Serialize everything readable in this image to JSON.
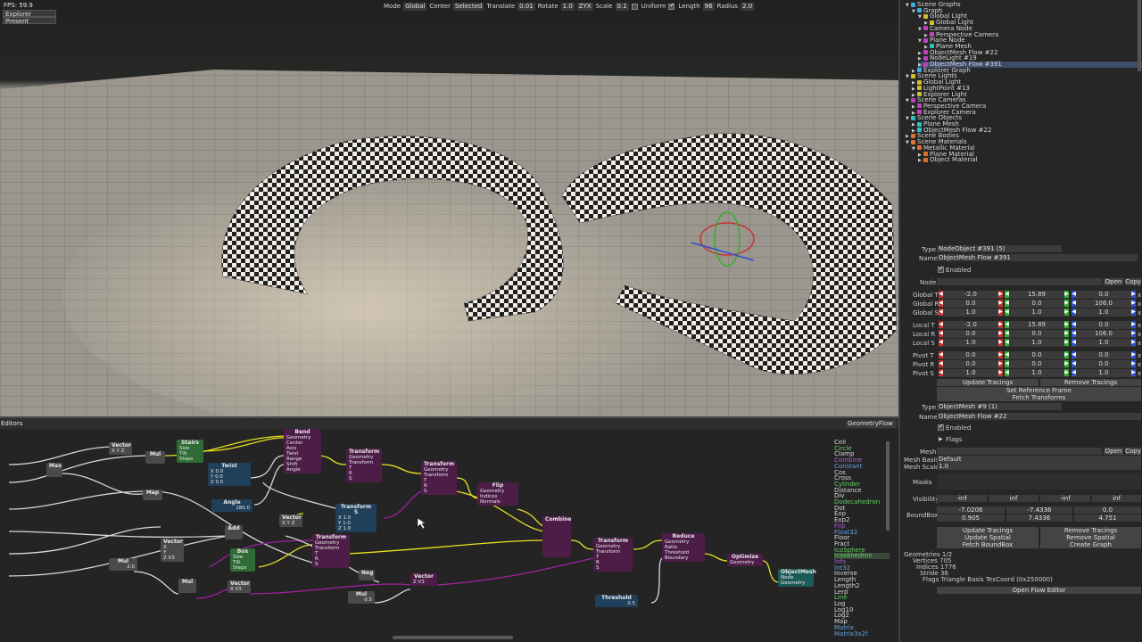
{
  "viewport": {
    "fps": "FPS: 59.9",
    "camera": "Explorer Camera",
    "present": "Present",
    "toolbar": {
      "mode_label": "Mode",
      "mode_value": "Global",
      "center_label": "Center",
      "center_value": "Selected",
      "translate_label": "Translate",
      "translate_value": "0.01",
      "rotate_label": "Rotate",
      "rotate_value": "1.0",
      "order_value": "ZYX",
      "scale_label": "Scale",
      "scale_value": "0.1",
      "uniform_label": "Uniform",
      "length_label": "Length",
      "length_value": "96",
      "radius_label": "Radius",
      "radius_value": "2.0"
    }
  },
  "editors": {
    "title": "Editors",
    "flow_type": "GeometryFlow",
    "nodes": {
      "vector1": {
        "title": "Vector",
        "rows": [
          "X Y Z"
        ]
      },
      "max": {
        "title": "Max"
      },
      "mul1": {
        "title": "Mul"
      },
      "stairs": {
        "title": "Stairs",
        "rows": [
          "Size",
          "Tilt",
          "Steps"
        ]
      },
      "twist": {
        "title": "Twist",
        "rows": [
          "X 0.0",
          "Y 0.0",
          "Z 0.0"
        ]
      },
      "angle": {
        "title": "Angle",
        "rows": [
          "180.0"
        ]
      },
      "bend": {
        "title": "Bend",
        "rows": [
          "Geometry",
          "Center",
          "Axis",
          "Twist",
          "Range",
          "Shift",
          "Angle"
        ]
      },
      "transform1": {
        "title": "Transform",
        "rows": [
          "Geometry",
          "Transform",
          "T",
          "R",
          "S"
        ]
      },
      "transform2": {
        "title": "Transform",
        "rows": [
          "Geometry",
          "Transform",
          "T",
          "R",
          "S"
        ]
      },
      "flip": {
        "title": "Flip",
        "rows": [
          "Geometry",
          "Indices",
          "Normals"
        ]
      },
      "transform_s": {
        "title": "Transform S",
        "rows": [
          "X 1.0",
          "Y 1.0",
          "Z 1.0"
        ]
      },
      "vector2": {
        "title": "Vector",
        "rows": [
          "X Y Z"
        ]
      },
      "map": {
        "title": "Map"
      },
      "add": {
        "title": "Add"
      },
      "transform3": {
        "title": "Transform",
        "rows": [
          "Geometry",
          "Transform",
          "T",
          "R",
          "S"
        ]
      },
      "box": {
        "title": "Box",
        "rows": [
          "Size",
          "Tilt",
          "Steps"
        ]
      },
      "vector3": {
        "title": "Vector",
        "rows": [
          "X",
          "Y",
          "Z V3"
        ]
      },
      "mul2": {
        "title": "Mul",
        "rows": [
          "2.0"
        ]
      },
      "mul3": {
        "title": "Mul"
      },
      "vector4": {
        "title": "Vector",
        "rows": [
          "X V3"
        ]
      },
      "neg": {
        "title": "Neg"
      },
      "mul4": {
        "title": "Mul",
        "rows": [
          "0.5"
        ]
      },
      "vector5": {
        "title": "Vector",
        "rows": [
          "Z V3"
        ]
      },
      "combine": {
        "title": "Combine"
      },
      "transform4": {
        "title": "Transform",
        "rows": [
          "Geometry",
          "Transform",
          "T",
          "R",
          "S"
        ]
      },
      "reduce": {
        "title": "Reduce",
        "rows": [
          "Geometry",
          "Ratio",
          "Threshold",
          "Boundary"
        ]
      },
      "threshold": {
        "title": "Threshold",
        "rows": [
          "0.5"
        ]
      },
      "optimize": {
        "title": "Optimize",
        "rows": [
          "Geometry"
        ]
      },
      "objectmesh": {
        "title": "ObjectMesh",
        "rows": [
          "Node",
          "Geometry"
        ]
      }
    },
    "palette": [
      {
        "label": "Cell",
        "color": "#d8d8d8"
      },
      {
        "label": "Circle",
        "color": "#5fd35f"
      },
      {
        "label": "Clamp",
        "color": "#d8d8d8"
      },
      {
        "label": "Combine",
        "color": "#b45ad8"
      },
      {
        "label": "Constant",
        "color": "#6aa0e0"
      },
      {
        "label": "Cos",
        "color": "#d8d8d8"
      },
      {
        "label": "Cross",
        "color": "#d8d8d8"
      },
      {
        "label": "Cylinder",
        "color": "#5fd35f"
      },
      {
        "label": "Distance",
        "color": "#d8d8d8"
      },
      {
        "label": "Div",
        "color": "#d8d8d8"
      },
      {
        "label": "Dodecahedron",
        "color": "#5fd35f"
      },
      {
        "label": "Dot",
        "color": "#d8d8d8"
      },
      {
        "label": "Exp",
        "color": "#d8d8d8"
      },
      {
        "label": "Exp2",
        "color": "#d8d8d8"
      },
      {
        "label": "Flip",
        "color": "#b45ad8"
      },
      {
        "label": "Float32",
        "color": "#6aa0e0"
      },
      {
        "label": "Floor",
        "color": "#d8d8d8"
      },
      {
        "label": "Fract",
        "color": "#d8d8d8"
      },
      {
        "label": "IcoSphere",
        "color": "#5fd35f"
      },
      {
        "label": "Icosahedron",
        "color": "#5fd35f"
      },
      {
        "label": "Info",
        "color": "#b45ad8"
      },
      {
        "label": "Int32",
        "color": "#6aa0e0"
      },
      {
        "label": "Inverse",
        "color": "#d8d8d8"
      },
      {
        "label": "Length",
        "color": "#d8d8d8"
      },
      {
        "label": "Length2",
        "color": "#d8d8d8"
      },
      {
        "label": "Lerp",
        "color": "#d8d8d8"
      },
      {
        "label": "Line",
        "color": "#5fd35f"
      },
      {
        "label": "Log",
        "color": "#d8d8d8"
      },
      {
        "label": "Log10",
        "color": "#d8d8d8"
      },
      {
        "label": "Log2",
        "color": "#d8d8d8"
      },
      {
        "label": "Map",
        "color": "#d8d8d8"
      },
      {
        "label": "Matrix",
        "color": "#6aa0e0"
      },
      {
        "label": "Matrix3x2f",
        "color": "#6aa0e0"
      }
    ]
  },
  "tree": [
    {
      "label": "Scene Graphs",
      "indent": 0,
      "icon": "#3ab0e0",
      "open": true
    },
    {
      "label": "Graph",
      "indent": 1,
      "icon": "#3ab0e0",
      "open": true
    },
    {
      "label": "Global Light",
      "indent": 2,
      "icon": "#d0c030",
      "open": true
    },
    {
      "label": "Global Light",
      "indent": 3,
      "icon": "#d0c030",
      "open": false
    },
    {
      "label": "Camera Node",
      "indent": 2,
      "icon": "#c040c0",
      "open": true
    },
    {
      "label": "Perspective Camera",
      "indent": 3,
      "icon": "#c040c0",
      "open": false
    },
    {
      "label": "Plane Node",
      "indent": 2,
      "icon": "#c040c0",
      "open": true
    },
    {
      "label": "Plane Mesh",
      "indent": 3,
      "icon": "#30c0c0",
      "open": false
    },
    {
      "label": "ObjectMesh Flow #22",
      "indent": 2,
      "icon": "#c040c0",
      "open": false
    },
    {
      "label": "NodeLight #19",
      "indent": 2,
      "icon": "#c040c0",
      "open": false
    },
    {
      "label": "ObjectMesh Flow #391",
      "indent": 2,
      "icon": "#c040c0",
      "open": false,
      "selected": true
    },
    {
      "label": "Explorer Graph",
      "indent": 1,
      "icon": "#3ab0e0",
      "open": false
    },
    {
      "label": "Scene Lights",
      "indent": 0,
      "icon": "#d0c030",
      "open": true
    },
    {
      "label": "Global Light",
      "indent": 1,
      "icon": "#d0c030",
      "open": false
    },
    {
      "label": "LightPoint #13",
      "indent": 1,
      "icon": "#d0c030",
      "open": false
    },
    {
      "label": "Explorer Light",
      "indent": 1,
      "icon": "#d0c030",
      "open": false
    },
    {
      "label": "Scene Cameras",
      "indent": 0,
      "icon": "#c040c0",
      "open": true
    },
    {
      "label": "Perspective Camera",
      "indent": 1,
      "icon": "#c040c0",
      "open": false
    },
    {
      "label": "Explorer Camera",
      "indent": 1,
      "icon": "#c040c0",
      "open": false
    },
    {
      "label": "Scene Objects",
      "indent": 0,
      "icon": "#30c0c0",
      "open": true
    },
    {
      "label": "Plane Mesh",
      "indent": 1,
      "icon": "#30c0c0",
      "open": false
    },
    {
      "label": "ObjectMesh Flow #22",
      "indent": 1,
      "icon": "#30c0c0",
      "open": false
    },
    {
      "label": "Scene Bodies",
      "indent": 0,
      "icon": "#e07030",
      "open": false
    },
    {
      "label": "Scene Materials",
      "indent": 0,
      "icon": "#e07030",
      "open": true
    },
    {
      "label": "Metallic Material",
      "indent": 1,
      "icon": "#e07030",
      "open": true
    },
    {
      "label": "Plane Material",
      "indent": 2,
      "icon": "#e07030",
      "open": false
    },
    {
      "label": "Object Material",
      "indent": 2,
      "icon": "#e07030",
      "open": false
    }
  ],
  "props": {
    "type_label": "Type",
    "type_value": "NodeObject #391 (5)",
    "name_label": "Name",
    "name_value": "ObjectMesh Flow #391",
    "enabled_label": "Enabled",
    "node_label": "Node",
    "open_label": "Open",
    "copy_label": "Copy",
    "transforms": [
      {
        "label": "Global T",
        "values": [
          "-2.0",
          "15.89",
          "0.0",
          "1.0"
        ]
      },
      {
        "label": "Global R",
        "values": [
          "0.0",
          "0.0",
          "106.0",
          "1.0"
        ]
      },
      {
        "label": "Global S",
        "values": [
          "1.0",
          "1.0",
          "1.0",
          "1.0"
        ]
      },
      {
        "label": "Local T",
        "values": [
          "-2.0",
          "15.89",
          "0.0",
          "1.0"
        ]
      },
      {
        "label": "Local R",
        "values": [
          "0.0",
          "0.0",
          "106.0",
          "1.0"
        ]
      },
      {
        "label": "Local S",
        "values": [
          "1.0",
          "1.0",
          "1.0",
          "1.0"
        ]
      },
      {
        "label": "Pivot T",
        "values": [
          "0.0",
          "0.0",
          "0.0",
          "1.0"
        ]
      },
      {
        "label": "Pivot R",
        "values": [
          "0.0",
          "0.0",
          "0.0",
          "1.0"
        ]
      },
      {
        "label": "Pivot S",
        "values": [
          "1.0",
          "1.0",
          "1.0",
          "1.0"
        ]
      }
    ],
    "update_tracings": "Update Tracings",
    "remove_tracings": "Remove Tracings",
    "set_reference_frame": "Set Reference Frame",
    "fetch_transforms": "Fetch Transforms",
    "type2_value": "ObjectMesh #9 (1)",
    "name2_value": "ObjectMesh Flow #22",
    "flags_label": "Flags",
    "mesh_label": "Mesh",
    "mesh_basis_label": "Mesh Basis",
    "mesh_basis_value": "Default",
    "mesh_scale_label": "Mesh Scale",
    "mesh_scale_value": "1.0",
    "masks_label": "Masks",
    "visibility_label": "Visibility",
    "visibility_values": [
      "-inf",
      "inf",
      "-inf",
      "inf"
    ],
    "boundbox_label": "BoundBox",
    "boundbox_row1": [
      "-7.0206",
      "-7.4336",
      "0.0"
    ],
    "boundbox_row2": [
      "0.905",
      "7.4336",
      "4.751"
    ],
    "update_spatial": "Update Spatial",
    "remove_spatial": "Remove Spatial",
    "fetch_boundbox": "Fetch BoundBox",
    "create_graph": "Create Graph",
    "geometries": "Geometries 1/2",
    "vertices": "Vertices 705",
    "indices": "Indices 1776",
    "stride": "Stride 36",
    "flags_value": "Flags  Triangle Basis TexCoord (0x250000)",
    "open_flow_editor": "Open Flow Editor"
  },
  "colors": {
    "accent_red": "#c83030",
    "accent_green": "#30b030",
    "accent_blue": "#3050d0",
    "wire_yellow": "#e8e020",
    "wire_purple": "#a020a0",
    "wire_white": "#d8d8d8"
  }
}
